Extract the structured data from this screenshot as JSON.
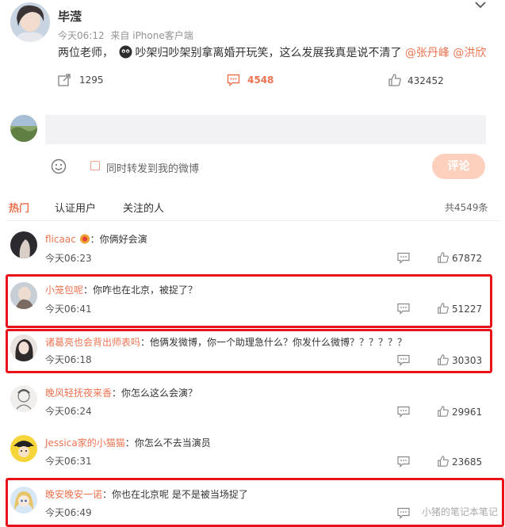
{
  "post": {
    "author": "毕滢",
    "time": "今天06:12",
    "source": "来自 iPhone客户端",
    "text_a": "两位老师，",
    "text_b": "吵架归吵架别拿离婚开玩笑，这么发展我真是说不清了",
    "mention1": "@张丹峰",
    "mention2": "@洪欣",
    "repost_count": "1295",
    "comment_count": "4548",
    "like_count": "432452"
  },
  "composer": {
    "checkbox_label": "同时转发到我的微博",
    "submit_label": "评论"
  },
  "tabs": {
    "hot": "热门",
    "verified": "认证用户",
    "following": "关注的人",
    "total": "共4549条"
  },
  "comments": [
    {
      "user": "flicaac",
      "sep": "：",
      "text": "你俩好会演",
      "time": "今天06:23",
      "likes": "67872"
    },
    {
      "user": "小笼包呢",
      "sep": "：",
      "text": "你咋也在北京，被捉了？",
      "time": "今天06:41",
      "likes": "51227"
    },
    {
      "user": "诸葛亮也会背出师表吗",
      "sep": "：",
      "text": "他俩发微博，你一个助理急什么？你发什么微博？？？？？？",
      "time": "今天06:18",
      "likes": "30303"
    },
    {
      "user": "晚风轻抚夜来香",
      "sep": "：",
      "text": "你怎么这么会演？",
      "time": "今天06:24",
      "likes": "29961"
    },
    {
      "user": "Jessica家的小猫猫",
      "sep": "：",
      "text": "你怎么不去当演员",
      "time": "今天06:31",
      "likes": "23685"
    },
    {
      "user": "晚安晚安一诺",
      "sep": "：",
      "text": "你也在北京呢 是不是被当场捉了",
      "time": "今天06:49",
      "likes": ""
    }
  ],
  "watermark": "小猪的笔记本笔记",
  "colors": {
    "accent": "#eb7350",
    "highlight_box": "#e8131a",
    "submit_bg": "#fdd0bd"
  }
}
